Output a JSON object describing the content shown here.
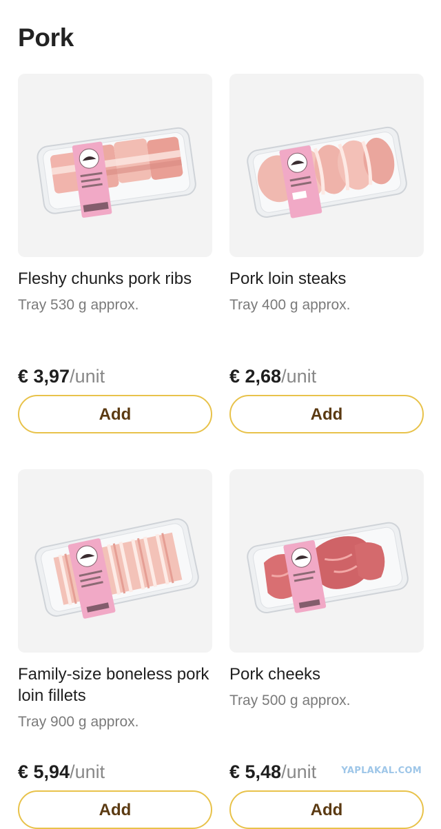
{
  "page": {
    "title": "Pork"
  },
  "colors": {
    "accent_border": "#e8c24a",
    "button_text": "#5b3a12",
    "tile_background": "#f3f3f3"
  },
  "products": [
    {
      "name": "Fleshy chunks pork ribs",
      "size": "Tray 530 g approx.",
      "price": "€ 3,97",
      "unit": "/unit",
      "add_label": "Add",
      "image_icon": "pork-ribs-tray-image"
    },
    {
      "name": "Pork loin steaks",
      "size": "Tray 400 g approx.",
      "price": "€ 2,68",
      "unit": "/unit",
      "add_label": "Add",
      "image_icon": "pork-loin-steaks-tray-image"
    },
    {
      "name": "Family-size boneless pork loin fillets",
      "size": "Tray 900 g approx.",
      "price": "€ 5,94",
      "unit": "/unit",
      "add_label": "Add",
      "image_icon": "pork-loin-fillets-tray-image"
    },
    {
      "name": "Pork cheeks",
      "size": "Tray 500 g approx.",
      "price": "€ 5,48",
      "unit": "/unit",
      "add_label": "Add",
      "image_icon": "pork-cheeks-tray-image"
    }
  ],
  "watermark": {
    "text": "YAPLAKAL.COM"
  }
}
